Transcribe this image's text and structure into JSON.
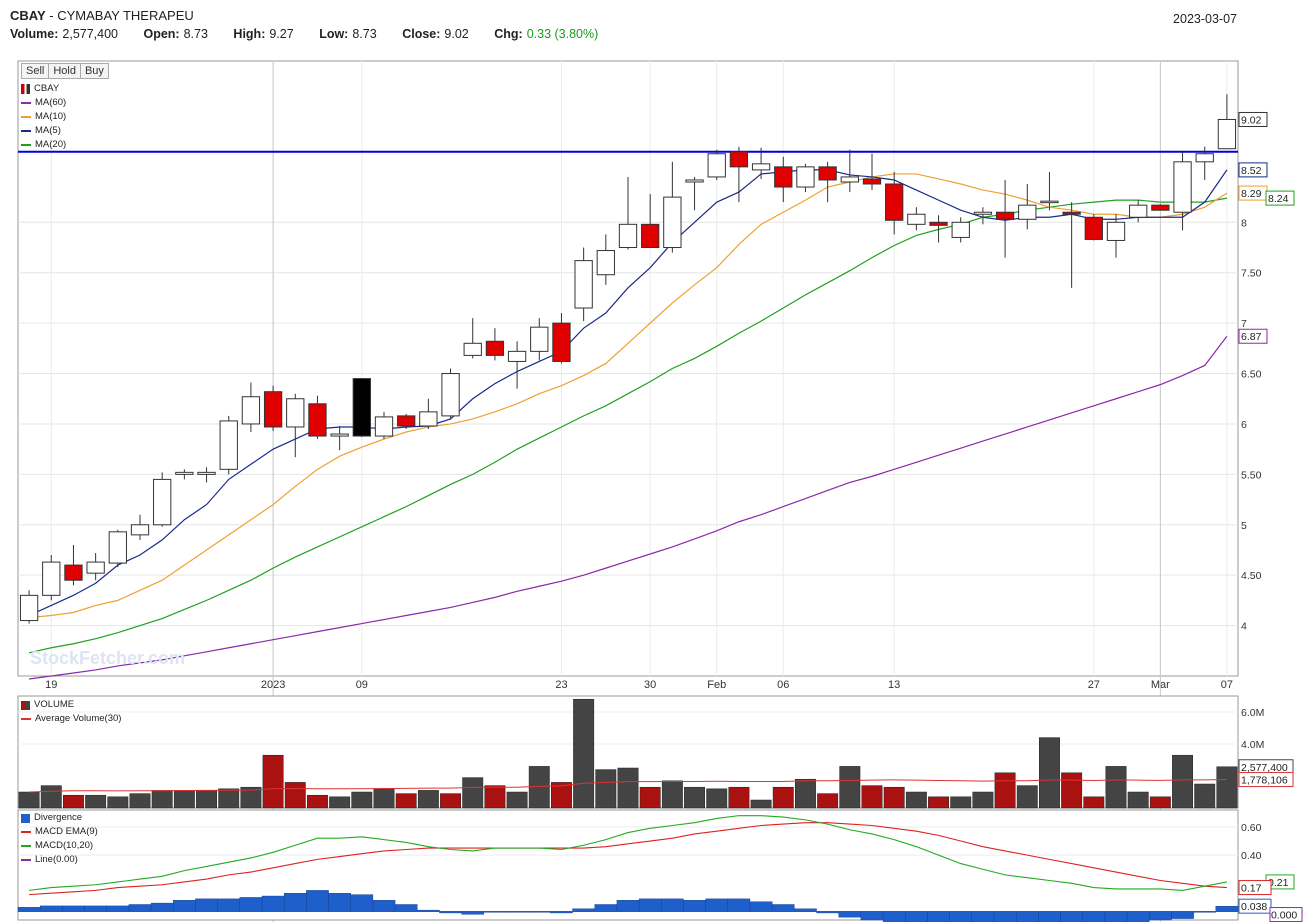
{
  "header": {
    "symbol": "CBAY",
    "name": " - CYMABAY THERAPEU",
    "date": "2023-03-07",
    "volume_label": "Volume:",
    "volume": "2,577,400",
    "open_label": "Open:",
    "open": "8.73",
    "high_label": "High:",
    "high": "9.27",
    "low_label": "Low:",
    "low": "8.73",
    "close_label": "Close:",
    "close": "9.02",
    "chg_label": "Chg:",
    "chg": "0.33 (3.80%)"
  },
  "buttons": {
    "sell": "Sell",
    "hold": "Hold",
    "buy": "Buy"
  },
  "watermark": "StockFetcher.com",
  "colors": {
    "up": "#ffffff",
    "down": "#e00000",
    "ma60": "#8a2aa8",
    "ma10": "#f0a030",
    "ma5": "#1a2a8a",
    "ma20": "#20a020",
    "hline": "#0000dd",
    "vol": "#444444",
    "voldown": "#aa1111",
    "avgvol": "#dd3333",
    "macd": "#22aa22",
    "ema": "#dd2222",
    "hist": "#1e5fcc"
  },
  "chart_data": [
    {
      "type": "candlestick",
      "legend": {
        "symbol": "CBAY",
        "ma60": "MA(60)",
        "ma10": "MA(10)",
        "ma5": "MA(5)",
        "ma20": "MA(20)"
      },
      "x_ticks": [
        "19",
        "2023",
        "09",
        "23",
        "30",
        "Feb",
        "06",
        "13",
        "27",
        "Mar",
        "07"
      ],
      "x_tick_index": [
        1,
        11,
        15,
        24,
        28,
        31,
        34,
        39,
        48,
        51,
        54
      ],
      "y_ticks": [
        "8",
        "7.50",
        "7",
        "6.50",
        "6",
        "5.50",
        "5",
        "4.50",
        "4"
      ],
      "y_tick_values": [
        8,
        7.5,
        7,
        6.5,
        6,
        5.5,
        5,
        4.5,
        4
      ],
      "ylim": [
        3.5,
        9.6
      ],
      "price_labels": [
        {
          "text": "9.02",
          "value": 9.02,
          "color": "#333333"
        },
        {
          "text": "8.52",
          "value": 8.52,
          "color": "#1a2a8a"
        },
        {
          "text": "8.29",
          "value": 8.29,
          "color": "#f0a030"
        },
        {
          "text": "8.24",
          "value": 8.24,
          "color": "#20a020"
        },
        {
          "text": "6.87",
          "value": 6.87,
          "color": "#8a2aa8"
        }
      ],
      "horizontal_line": 8.7,
      "candles": [
        [
          4.05,
          4.35,
          4.02,
          4.3
        ],
        [
          4.3,
          4.7,
          4.25,
          4.63
        ],
        [
          4.6,
          4.8,
          4.4,
          4.45
        ],
        [
          4.52,
          4.72,
          4.45,
          4.63
        ],
        [
          4.62,
          4.95,
          4.58,
          4.93
        ],
        [
          4.9,
          5.1,
          4.85,
          5.0
        ],
        [
          5.0,
          5.52,
          4.98,
          5.45
        ],
        [
          5.5,
          5.55,
          5.45,
          5.52
        ],
        [
          5.5,
          5.57,
          5.42,
          5.52
        ],
        [
          5.55,
          6.08,
          5.5,
          6.03
        ],
        [
          6.0,
          6.41,
          5.92,
          6.27
        ],
        [
          6.32,
          6.38,
          5.93,
          5.97
        ],
        [
          5.97,
          6.3,
          5.67,
          6.25
        ],
        [
          6.2,
          6.28,
          5.85,
          5.88
        ],
        [
          5.88,
          5.98,
          5.74,
          5.9
        ],
        [
          5.88,
          6.45,
          5.87,
          6.45
        ],
        [
          5.88,
          6.12,
          5.85,
          6.07
        ],
        [
          6.08,
          6.1,
          5.95,
          5.98
        ],
        [
          5.98,
          6.25,
          5.95,
          6.12
        ],
        [
          6.08,
          6.55,
          6.05,
          6.5
        ],
        [
          6.68,
          7.05,
          6.65,
          6.8
        ],
        [
          6.82,
          6.95,
          6.63,
          6.68
        ],
        [
          6.62,
          6.82,
          6.35,
          6.72
        ],
        [
          6.72,
          7.05,
          6.63,
          6.96
        ],
        [
          7.0,
          7.1,
          6.6,
          6.62
        ],
        [
          7.15,
          7.75,
          7.02,
          7.62
        ],
        [
          7.48,
          7.88,
          7.38,
          7.72
        ],
        [
          7.75,
          8.45,
          7.73,
          7.98
        ],
        [
          7.98,
          8.28,
          7.75,
          7.75
        ],
        [
          7.75,
          8.6,
          7.7,
          8.25
        ],
        [
          8.4,
          8.45,
          8.12,
          8.42
        ],
        [
          8.45,
          8.72,
          8.42,
          8.68
        ],
        [
          8.7,
          8.75,
          8.2,
          8.55
        ],
        [
          8.52,
          8.74,
          8.43,
          8.58
        ],
        [
          8.55,
          8.65,
          8.2,
          8.35
        ],
        [
          8.35,
          8.58,
          8.3,
          8.55
        ],
        [
          8.55,
          8.6,
          8.2,
          8.42
        ],
        [
          8.4,
          8.72,
          8.3,
          8.45
        ],
        [
          8.43,
          8.68,
          8.32,
          8.38
        ],
        [
          8.38,
          8.5,
          7.88,
          8.02
        ],
        [
          7.98,
          8.15,
          7.92,
          8.08
        ],
        [
          8.0,
          8.07,
          7.8,
          7.97
        ],
        [
          7.85,
          8.05,
          7.8,
          8.0
        ],
        [
          8.08,
          8.15,
          7.98,
          8.1
        ],
        [
          8.1,
          8.42,
          7.65,
          8.03
        ],
        [
          8.03,
          8.38,
          7.93,
          8.17
        ],
        [
          8.2,
          8.5,
          8.12,
          8.21
        ],
        [
          8.1,
          8.2,
          7.35,
          8.08
        ],
        [
          8.05,
          8.08,
          7.82,
          7.83
        ],
        [
          7.82,
          8.08,
          7.65,
          8.0
        ],
        [
          8.05,
          8.22,
          8.0,
          8.17
        ],
        [
          8.17,
          8.18,
          8.12,
          8.12
        ],
        [
          8.1,
          8.7,
          7.92,
          8.6
        ],
        [
          8.6,
          8.75,
          8.42,
          8.68
        ],
        [
          8.73,
          9.27,
          8.73,
          9.02
        ]
      ],
      "ma5": [
        4.1,
        4.2,
        4.3,
        4.42,
        4.6,
        4.7,
        4.85,
        5.05,
        5.2,
        5.45,
        5.6,
        5.75,
        5.85,
        5.95,
        5.97,
        5.97,
        5.95,
        5.97,
        5.98,
        6.05,
        6.25,
        6.4,
        6.52,
        6.62,
        6.72,
        6.95,
        7.1,
        7.35,
        7.55,
        7.8,
        8.0,
        8.2,
        8.3,
        8.48,
        8.5,
        8.52,
        8.52,
        8.47,
        8.45,
        8.42,
        8.32,
        8.22,
        8.12,
        8.05,
        8.02,
        8.05,
        8.05,
        8.08,
        8.03,
        8.03,
        8.05,
        8.05,
        8.05,
        8.2,
        8.52
      ],
      "ma10": [
        4.08,
        4.1,
        4.13,
        4.2,
        4.25,
        4.35,
        4.45,
        4.6,
        4.75,
        4.9,
        5.05,
        5.2,
        5.38,
        5.55,
        5.68,
        5.77,
        5.85,
        5.92,
        5.97,
        6.0,
        6.05,
        6.12,
        6.2,
        6.3,
        6.38,
        6.48,
        6.6,
        6.8,
        7.0,
        7.2,
        7.38,
        7.55,
        7.78,
        7.98,
        8.1,
        8.22,
        8.35,
        8.4,
        8.45,
        8.48,
        8.48,
        8.43,
        8.38,
        8.32,
        8.28,
        8.22,
        8.15,
        8.12,
        8.08,
        8.08,
        8.05,
        8.05,
        8.08,
        8.15,
        8.29
      ],
      "ma20": [
        3.73,
        3.78,
        3.82,
        3.87,
        3.93,
        4.0,
        4.07,
        4.16,
        4.25,
        4.35,
        4.45,
        4.57,
        4.68,
        4.78,
        4.88,
        4.98,
        5.08,
        5.18,
        5.29,
        5.4,
        5.5,
        5.62,
        5.75,
        5.86,
        5.97,
        6.08,
        6.18,
        6.3,
        6.42,
        6.55,
        6.65,
        6.77,
        6.9,
        7.02,
        7.15,
        7.28,
        7.4,
        7.52,
        7.65,
        7.77,
        7.87,
        7.93,
        7.98,
        8.05,
        8.08,
        8.12,
        8.15,
        8.18,
        8.2,
        8.22,
        8.22,
        8.2,
        8.2,
        8.2,
        8.24
      ],
      "ma60": [
        3.47,
        3.5,
        3.53,
        3.56,
        3.6,
        3.63,
        3.66,
        3.7,
        3.74,
        3.78,
        3.82,
        3.86,
        3.9,
        3.94,
        3.98,
        4.02,
        4.06,
        4.1,
        4.14,
        4.18,
        4.23,
        4.28,
        4.34,
        4.39,
        4.44,
        4.5,
        4.57,
        4.64,
        4.71,
        4.78,
        4.86,
        4.94,
        5.03,
        5.1,
        5.18,
        5.26,
        5.34,
        5.42,
        5.48,
        5.55,
        5.62,
        5.69,
        5.76,
        5.83,
        5.9,
        5.97,
        6.04,
        6.11,
        6.18,
        6.25,
        6.32,
        6.39,
        6.48,
        6.58,
        6.87
      ]
    },
    {
      "type": "bar",
      "legend": {
        "volume": "VOLUME",
        "avg": "Average Volume(30)"
      },
      "y_ticks": [
        "6.0M",
        "4.0M"
      ],
      "y_tick_values": [
        6000000,
        4000000
      ],
      "ylim": [
        0,
        7000000
      ],
      "value_labels": [
        {
          "text": "2,577,400",
          "value": 2577400
        },
        {
          "text": "1,778,106",
          "value": 1778106
        }
      ],
      "volume": [
        1000000,
        1400000,
        800000,
        800000,
        700000,
        900000,
        1100000,
        1100000,
        1100000,
        1200000,
        1300000,
        3300000,
        1600000,
        800000,
        700000,
        1000000,
        1200000,
        900000,
        1100000,
        900000,
        1900000,
        1400000,
        1000000,
        2600000,
        1600000,
        6800000,
        2400000,
        2500000,
        1300000,
        1700000,
        1300000,
        1200000,
        1300000,
        500000,
        1300000,
        1800000,
        900000,
        2600000,
        1400000,
        1300000,
        1000000,
        700000,
        700000,
        1000000,
        2200000,
        1400000,
        4400000,
        2200000,
        700000,
        2600000,
        1000000,
        700000,
        3300000,
        1500000,
        2577400
      ],
      "down": [
        false,
        false,
        true,
        false,
        false,
        false,
        false,
        false,
        false,
        false,
        false,
        true,
        true,
        true,
        false,
        false,
        false,
        true,
        false,
        true,
        false,
        true,
        false,
        false,
        true,
        false,
        false,
        false,
        true,
        false,
        false,
        false,
        true,
        false,
        true,
        false,
        true,
        false,
        true,
        true,
        false,
        true,
        false,
        false,
        true,
        false,
        false,
        true,
        true,
        false,
        false,
        true,
        false,
        false,
        false
      ],
      "avg": [
        1000000,
        1050000,
        1080000,
        1080000,
        1070000,
        1080000,
        1080000,
        1090000,
        1100000,
        1110000,
        1120000,
        1200000,
        1220000,
        1200000,
        1200000,
        1200000,
        1220000,
        1230000,
        1240000,
        1240000,
        1290000,
        1300000,
        1300000,
        1350000,
        1380000,
        1550000,
        1600000,
        1650000,
        1650000,
        1660000,
        1660000,
        1670000,
        1660000,
        1660000,
        1660000,
        1700000,
        1700000,
        1720000,
        1740000,
        1760000,
        1740000,
        1720000,
        1700000,
        1680000,
        1700000,
        1700000,
        1750000,
        1750000,
        1720000,
        1760000,
        1740000,
        1730000,
        1760000,
        1760000,
        1778106
      ]
    },
    {
      "type": "line",
      "legend": {
        "divergence": "Divergence",
        "ema": "MACD EMA(9)",
        "macd": "MACD(10,20)",
        "line": "Line(0.00)"
      },
      "y_ticks": [
        "0.60",
        "0.40"
      ],
      "y_tick_values": [
        0.6,
        0.4
      ],
      "ylim": [
        -0.06,
        0.72
      ],
      "value_labels": [
        {
          "text": "0.21",
          "value": 0.21,
          "color": "#22aa22"
        },
        {
          "text": "0.17",
          "value": 0.17,
          "color": "#dd2222"
        },
        {
          "text": "0.038",
          "value": 0.038,
          "color": "#1e5fcc"
        },
        {
          "text": "0.000",
          "value": 0.0,
          "color": "#8a2aa8"
        }
      ],
      "macd": [
        0.15,
        0.17,
        0.18,
        0.19,
        0.21,
        0.23,
        0.25,
        0.29,
        0.32,
        0.35,
        0.38,
        0.42,
        0.47,
        0.52,
        0.52,
        0.53,
        0.51,
        0.49,
        0.46,
        0.44,
        0.43,
        0.45,
        0.45,
        0.45,
        0.44,
        0.47,
        0.51,
        0.56,
        0.59,
        0.61,
        0.63,
        0.66,
        0.68,
        0.68,
        0.67,
        0.65,
        0.62,
        0.58,
        0.55,
        0.51,
        0.46,
        0.4,
        0.34,
        0.3,
        0.26,
        0.24,
        0.22,
        0.2,
        0.17,
        0.16,
        0.16,
        0.16,
        0.15,
        0.18,
        0.21
      ],
      "ema": [
        0.12,
        0.13,
        0.14,
        0.15,
        0.17,
        0.18,
        0.19,
        0.21,
        0.23,
        0.26,
        0.28,
        0.31,
        0.34,
        0.37,
        0.39,
        0.41,
        0.43,
        0.44,
        0.45,
        0.45,
        0.45,
        0.45,
        0.45,
        0.45,
        0.45,
        0.45,
        0.46,
        0.48,
        0.5,
        0.52,
        0.55,
        0.57,
        0.59,
        0.61,
        0.62,
        0.63,
        0.63,
        0.62,
        0.61,
        0.59,
        0.57,
        0.54,
        0.5,
        0.46,
        0.43,
        0.4,
        0.37,
        0.34,
        0.31,
        0.28,
        0.25,
        0.22,
        0.2,
        0.18,
        0.17
      ],
      "hist": [
        0.03,
        0.04,
        0.04,
        0.04,
        0.04,
        0.05,
        0.06,
        0.08,
        0.09,
        0.09,
        0.1,
        0.11,
        0.13,
        0.15,
        0.13,
        0.12,
        0.08,
        0.05,
        0.01,
        -0.01,
        -0.02,
        0.0,
        0.0,
        0.0,
        -0.01,
        0.02,
        0.05,
        0.08,
        0.09,
        0.09,
        0.08,
        0.09,
        0.09,
        0.07,
        0.05,
        0.02,
        -0.01,
        -0.04,
        -0.06,
        -0.08,
        -0.11,
        -0.14,
        -0.16,
        -0.16,
        -0.17,
        -0.16,
        -0.15,
        -0.14,
        -0.14,
        -0.12,
        -0.09,
        -0.06,
        -0.05,
        0.0,
        0.038
      ]
    }
  ]
}
